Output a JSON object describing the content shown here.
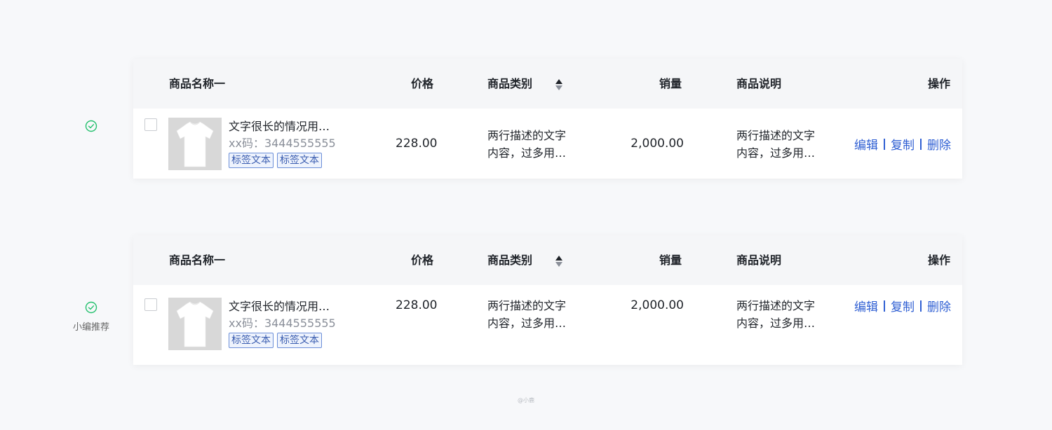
{
  "colors": {
    "background": "#f7f8fa",
    "header_bg": "#f5f6f8",
    "success_green": "#22c06c",
    "link_blue": "#2f5fd3",
    "tag_blue": "#3a5db0",
    "thumbnail_bg": "#d8d8d8"
  },
  "columns": {
    "name": "商品名称一",
    "price": "价格",
    "category": "商品类别",
    "sales": "销量",
    "description": "商品说明",
    "actions": "操作"
  },
  "rows": [
    {
      "side_marker": {
        "icon": "check-circle-icon",
        "label": ""
      },
      "product": {
        "name": "文字很长的情况用…",
        "code": "xx码：3444555555",
        "tags": [
          "标签文本",
          "标签文本"
        ],
        "image": "tshirt-image"
      },
      "price": "228.00",
      "category_lines": [
        "两行描述的文字",
        "内容，过多用…"
      ],
      "sales": "2,000.00",
      "description_lines": [
        "两行描述的文字",
        "内容，过多用…"
      ],
      "actions": {
        "edit": "编辑",
        "copy": "复制",
        "delete": "删除"
      }
    },
    {
      "side_marker": {
        "icon": "check-circle-icon",
        "label": "小编推荐"
      },
      "product": {
        "name": "文字很长的情况用…",
        "code": "xx码：3444555555",
        "tags": [
          "标签文本",
          "标签文本"
        ],
        "image": "tshirt-image"
      },
      "price": "228.00",
      "category_lines": [
        "两行描述的文字",
        "内容，过多用…"
      ],
      "sales": "2,000.00",
      "description_lines": [
        "两行描述的文字",
        "内容，过多用…"
      ],
      "actions": {
        "edit": "编辑",
        "copy": "复制",
        "delete": "删除"
      }
    }
  ],
  "watermark": "@小鹿"
}
